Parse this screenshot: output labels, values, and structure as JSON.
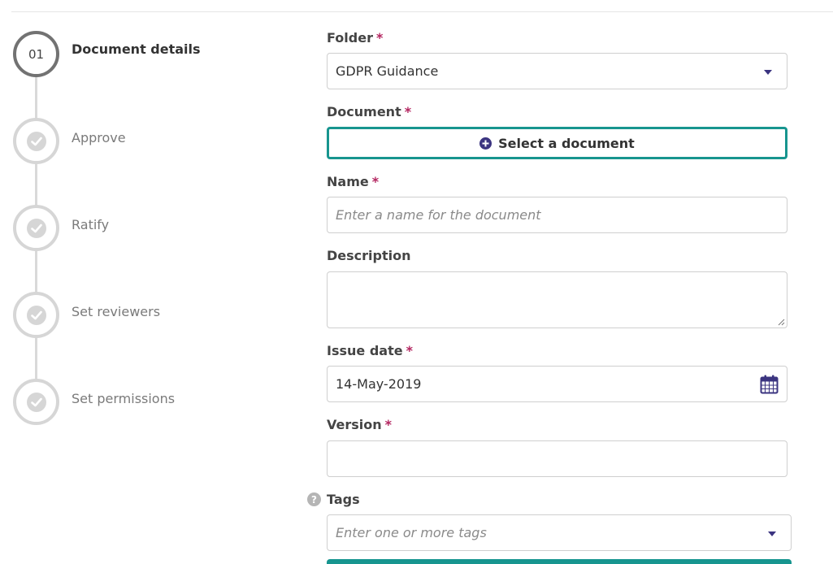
{
  "stepper": {
    "steps": [
      {
        "number": "01",
        "label": "Document details",
        "state": "active"
      },
      {
        "number": "",
        "label": "Approve",
        "state": "pending"
      },
      {
        "number": "",
        "label": "Ratify",
        "state": "pending"
      },
      {
        "number": "",
        "label": "Set reviewers",
        "state": "pending"
      },
      {
        "number": "",
        "label": "Set permissions",
        "state": "pending"
      }
    ]
  },
  "form": {
    "folder": {
      "label": "Folder",
      "required_mark": "*",
      "value": "GDPR Guidance"
    },
    "document": {
      "label": "Document",
      "required_mark": "*",
      "button_label": "Select a document"
    },
    "name": {
      "label": "Name",
      "required_mark": "*",
      "placeholder": "Enter a name for the document",
      "value": ""
    },
    "description": {
      "label": "Description",
      "value": ""
    },
    "issue_date": {
      "label": "Issue date",
      "required_mark": "*",
      "value": "14-May-2019"
    },
    "version": {
      "label": "Version",
      "required_mark": "*",
      "value": ""
    },
    "tags": {
      "label": "Tags",
      "help_glyph": "?",
      "placeholder": "Enter one or more tags"
    }
  },
  "icons": {
    "plus": "plus-circle-icon",
    "calendar": "calendar-icon",
    "caret": "caret-down-icon",
    "check": "check-icon",
    "help": "question-circle-icon"
  },
  "colors": {
    "accent_teal": "#17958f",
    "brand_purple": "#3b3480",
    "required": "#b3245f",
    "step_active_border": "#727272",
    "step_inactive": "#d6d6d6"
  }
}
